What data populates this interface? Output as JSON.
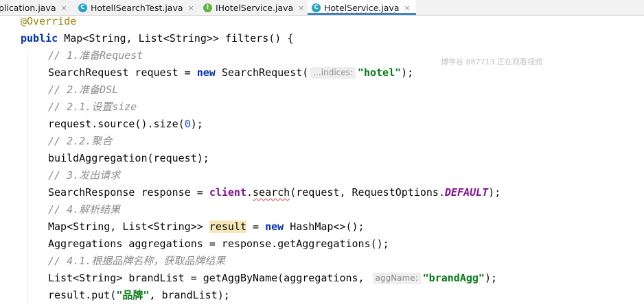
{
  "tabs": [
    {
      "label": "plication.java",
      "icon": "none",
      "active": false
    },
    {
      "label": "HotelISearchTest.java",
      "icon": "class-icon",
      "active": false
    },
    {
      "label": "IHotelService.java",
      "icon": "interface-icon",
      "active": false
    },
    {
      "label": "HotelService.java",
      "icon": "class-icon",
      "active": true
    }
  ],
  "tab_close_glyph": "×",
  "icon_letters": {
    "class": "C",
    "interface": "I"
  },
  "watermark": "博学谷 887713 正在观看视频",
  "code": {
    "l1": {
      "annotation": "@Override"
    },
    "l2": {
      "kw": "public",
      "text": " Map<String, List<String>> filters() {"
    },
    "l3": {
      "comment": "// 1.准备Request"
    },
    "l4": {
      "a": "SearchRequest request = ",
      "kw": "new",
      "b": " SearchRequest(",
      "hint": "...indices:",
      "str": "\"hotel\"",
      "c": ");"
    },
    "l5": {
      "comment": "// 2.准备DSL"
    },
    "l6": {
      "comment": "// 2.1.设置size"
    },
    "l7": {
      "a": "request.source().size(",
      "num": "0",
      "b": ");"
    },
    "l8": {
      "comment": "// 2.2.聚合"
    },
    "l9": {
      "text": "buildAggregation(request);"
    },
    "l10": {
      "comment": "// 3.发出请求"
    },
    "l11": {
      "a": "SearchResponse response = ",
      "field": "client",
      "b": ".",
      "method": "search",
      "c": "(request, RequestOptions.",
      "const": "DEFAULT",
      "d": ");"
    },
    "l12": {
      "comment": "// 4.解析结果"
    },
    "l13": {
      "a": "Map<String, List<String>> ",
      "var": "result",
      "b": " = ",
      "kw": "new",
      "c": " HashMap<>();"
    },
    "l14": {
      "text": "Aggregations aggregations = response.getAggregations();"
    },
    "l15": {
      "comment": "// 4.1.根据品牌名称，获取品牌结果"
    },
    "l16": {
      "a": "List<String> brandList = getAggByName(aggregations, ",
      "hint": "aggName:",
      "str": "\"brandAgg\"",
      "b": ");"
    },
    "l17": {
      "a": "result.put(",
      "str": "\"品牌\"",
      "b": ", brandList);"
    }
  }
}
